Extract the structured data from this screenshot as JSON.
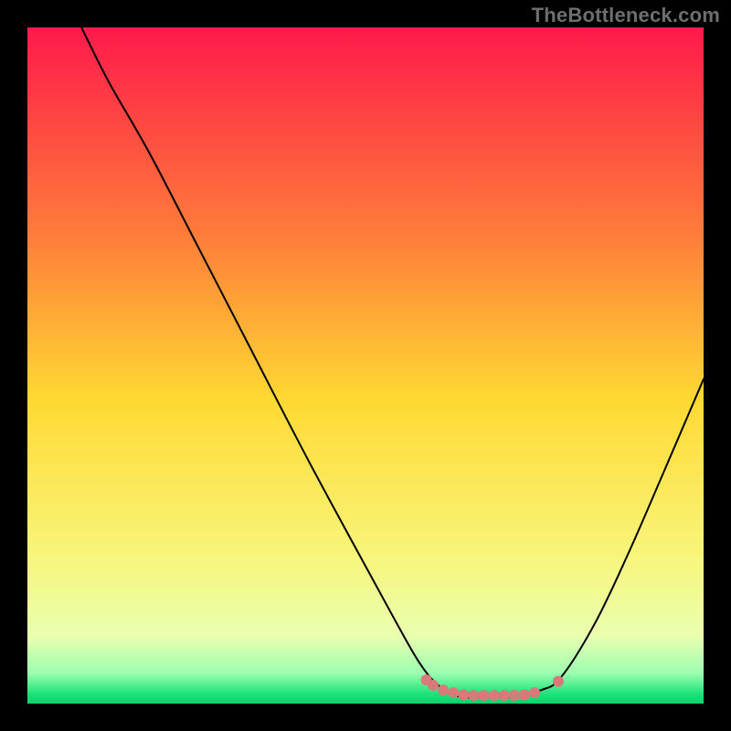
{
  "watermark": "TheBottleneck.com",
  "chart_data": {
    "type": "line",
    "title": "",
    "xlabel": "",
    "ylabel": "",
    "xlim": [
      0,
      100
    ],
    "ylim": [
      0,
      100
    ],
    "grid": false,
    "legend": false,
    "background_gradient_stops": [
      {
        "offset": 0.0,
        "color": "#ff1a4b"
      },
      {
        "offset": 0.3,
        "color": "#ff7a3a"
      },
      {
        "offset": 0.55,
        "color": "#ffd932"
      },
      {
        "offset": 0.78,
        "color": "#f8f57a"
      },
      {
        "offset": 0.9,
        "color": "#eaffb0"
      },
      {
        "offset": 0.955,
        "color": "#9cffb0"
      },
      {
        "offset": 0.985,
        "color": "#1fe27a"
      },
      {
        "offset": 1.0,
        "color": "#0bd36b"
      }
    ],
    "series": [
      {
        "name": "bottleneck-curve",
        "color": "#000000",
        "width": 2,
        "points": [
          {
            "x": 8.0,
            "y": 100.0
          },
          {
            "x": 12.0,
            "y": 92.0
          },
          {
            "x": 18.0,
            "y": 81.5
          },
          {
            "x": 25.0,
            "y": 68.0
          },
          {
            "x": 33.0,
            "y": 52.5
          },
          {
            "x": 41.0,
            "y": 37.0
          },
          {
            "x": 48.0,
            "y": 24.0
          },
          {
            "x": 54.0,
            "y": 13.0
          },
          {
            "x": 58.0,
            "y": 6.0
          },
          {
            "x": 61.0,
            "y": 2.5
          },
          {
            "x": 64.0,
            "y": 1.0
          },
          {
            "x": 68.0,
            "y": 1.0
          },
          {
            "x": 72.0,
            "y": 1.0
          },
          {
            "x": 76.0,
            "y": 2.0
          },
          {
            "x": 79.0,
            "y": 4.0
          },
          {
            "x": 84.0,
            "y": 12.0
          },
          {
            "x": 89.0,
            "y": 22.5
          },
          {
            "x": 94.0,
            "y": 34.0
          },
          {
            "x": 100.0,
            "y": 48.0
          }
        ]
      }
    ],
    "markers": [
      {
        "name": "optimal-band",
        "color": "#d87a7a",
        "points": [
          {
            "x": 59.0,
            "y": 3.5,
            "r": 6
          },
          {
            "x": 60.0,
            "y": 2.7,
            "r": 6
          },
          {
            "x": 61.5,
            "y": 2.0,
            "r": 6
          },
          {
            "x": 63.0,
            "y": 1.6,
            "r": 6
          },
          {
            "x": 64.5,
            "y": 1.3,
            "r": 6
          },
          {
            "x": 66.0,
            "y": 1.2,
            "r": 6
          },
          {
            "x": 67.5,
            "y": 1.2,
            "r": 6
          },
          {
            "x": 69.0,
            "y": 1.2,
            "r": 6
          },
          {
            "x": 70.5,
            "y": 1.2,
            "r": 6
          },
          {
            "x": 72.0,
            "y": 1.2,
            "r": 6
          },
          {
            "x": 73.5,
            "y": 1.3,
            "r": 6
          },
          {
            "x": 75.0,
            "y": 1.6,
            "r": 6
          },
          {
            "x": 78.5,
            "y": 3.3,
            "r": 6
          }
        ]
      }
    ]
  }
}
